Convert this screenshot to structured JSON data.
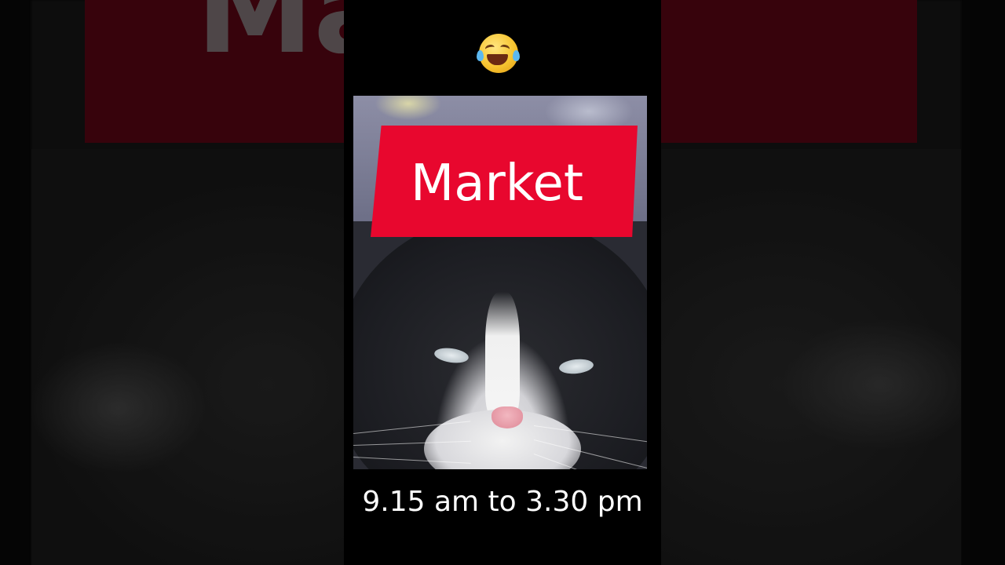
{
  "overlay": {
    "emoji": "😂",
    "emoji_name": "face-with-tears-of-joy",
    "banner_text": "Market",
    "caption": "9.15 am to 3.30 pm"
  },
  "colors": {
    "banner": "#e8072e",
    "banner_text": "#ffffff",
    "caption_text": "#ffffff",
    "background": "#000000"
  }
}
